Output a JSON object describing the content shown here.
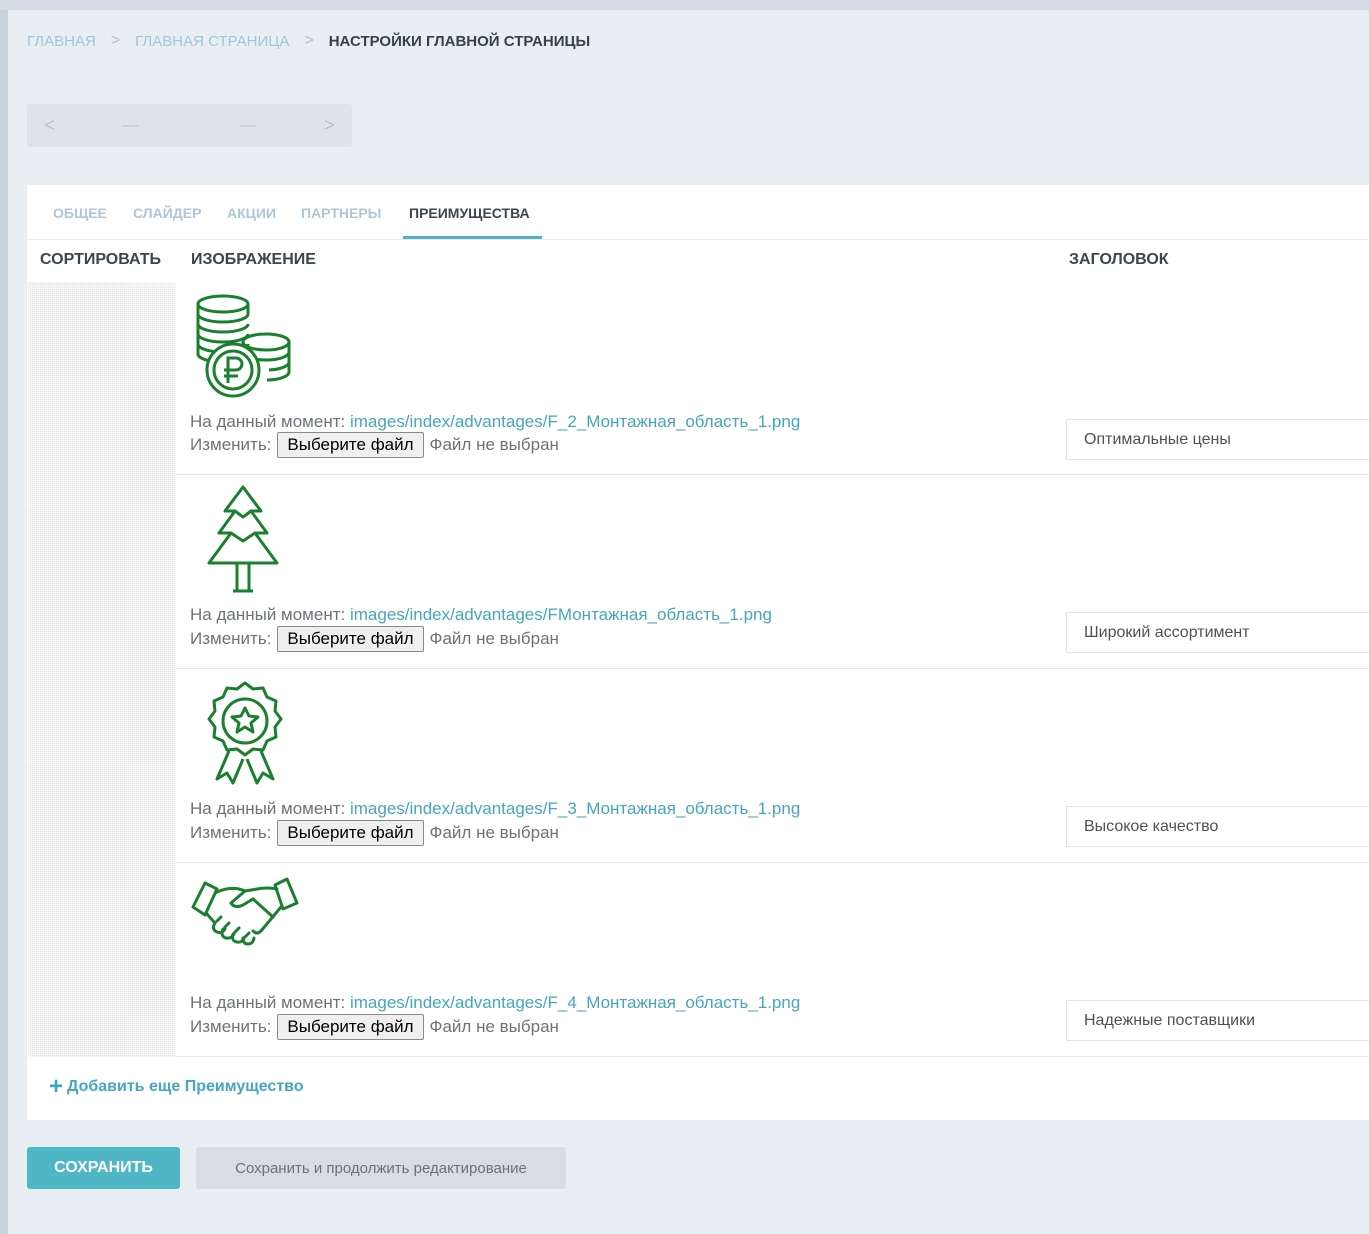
{
  "breadcrumb": {
    "items": [
      "Главная",
      "Главная страница"
    ],
    "current": "Настройки главной страницы",
    "separator": ">"
  },
  "lang_switch": {
    "prev": "<",
    "next": ">",
    "left_dash": "—",
    "right_dash": "—"
  },
  "tabs": [
    "Общее",
    "Слайдер",
    "Акции",
    "Партнеры",
    "Преимущества"
  ],
  "active_tab": "Преимущества",
  "table": {
    "headers": {
      "sort": "Сортировать",
      "image": "Изображение",
      "title": "Заголовок"
    }
  },
  "rows": [
    {
      "icon": "coins-ruble-icon",
      "current_label": "На данный момент:",
      "file_path": "images/index/advantages/F_2_Монтажная_область_1.png",
      "change_label": "Изменить:",
      "file_button": "Выберите файл",
      "file_status": "Файл не выбран",
      "title": "Оптимальные цены"
    },
    {
      "icon": "fir-tree-icon",
      "current_label": "На данный момент:",
      "file_path": "images/index/advantages/FМонтажная_область_1.png",
      "change_label": "Изменить:",
      "file_button": "Выберите файл",
      "file_status": "Файл не выбран",
      "title": "Широкий ассортимент"
    },
    {
      "icon": "award-badge-icon",
      "current_label": "На данный момент:",
      "file_path": "images/index/advantages/F_3_Монтажная_область_1.png",
      "change_label": "Изменить:",
      "file_button": "Выберите файл",
      "file_status": "Файл не выбран",
      "title": "Высокое качество"
    },
    {
      "icon": "handshake-icon",
      "current_label": "На данный момент:",
      "file_path": "images/index/advantages/F_4_Монтажная_область_1.png",
      "change_label": "Изменить:",
      "file_button": "Выберите файл",
      "file_status": "Файл не выбран",
      "title": "Надежные поставщики"
    }
  ],
  "add_more": {
    "icon": "plus-icon",
    "label": "Добавить еще Преимущество"
  },
  "actions": {
    "save": "Сохранить",
    "save_continue": "Сохранить и продолжить редактирование"
  },
  "colors": {
    "accent": "#4fb6c6",
    "link": "#45a6bd",
    "icon_green": "#1a7f2e",
    "background": "#e9eef3"
  }
}
